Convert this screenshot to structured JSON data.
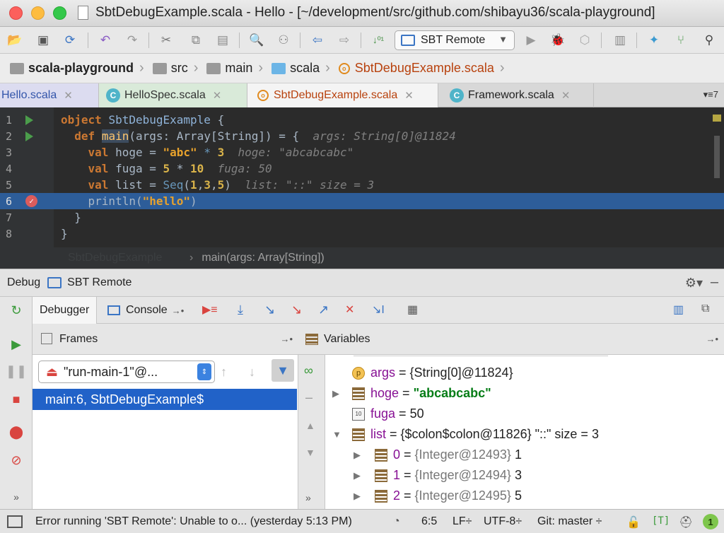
{
  "window": {
    "title": "SbtDebugExample.scala - Hello - [~/development/src/github.com/shibayu36/scala-playground]"
  },
  "toolbar": {
    "run_config_label": "SBT Remote"
  },
  "navbar": {
    "project": "scala-playground",
    "folders": [
      "src",
      "main",
      "scala"
    ],
    "file": "SbtDebugExample.scala"
  },
  "tabs": [
    {
      "label": "Hello.scala"
    },
    {
      "label": "HelloSpec.scala"
    },
    {
      "label": "SbtDebugExample.scala"
    },
    {
      "label": "Framework.scala"
    }
  ],
  "tabs_more": "7",
  "editor": {
    "line_numbers": [
      "1",
      "2",
      "3",
      "4",
      "5",
      "6",
      "7",
      "8"
    ],
    "hints": {
      "line2": "args: String[0]@11824",
      "line3": "hoge: \"abcabcabc\"",
      "line4": "fuga: 50",
      "line5": "list: \"::\" size = 3"
    },
    "breadcrumb_faded": "SbtDebugExample",
    "breadcrumb": "main(args: Array[String])"
  },
  "debug": {
    "label": "Debug",
    "config": "SBT Remote",
    "tab_debugger": "Debugger",
    "tab_console": "Console"
  },
  "frames": {
    "title": "Frames",
    "thread": "\"run-main-1\"@...",
    "selected_frame": "main:6, SbtDebugExample$"
  },
  "variables": {
    "title": "Variables",
    "rows": [
      {
        "name": "args",
        "value": "{String[0]@11824}"
      },
      {
        "name": "hoge",
        "value": "\"abcabcabc\""
      },
      {
        "name": "fuga",
        "value": "50"
      },
      {
        "name": "list",
        "value": "{$colon$colon@11826}",
        "extra": "\"::\" size = 3"
      },
      {
        "name": "0",
        "value": "{Integer@12493}",
        "extra": "1"
      },
      {
        "name": "1",
        "value": "{Integer@12494}",
        "extra": "3"
      },
      {
        "name": "2",
        "value": "{Integer@12495}",
        "extra": "5"
      }
    ]
  },
  "status": {
    "message": "Error running 'SBT Remote': Unable to o... (yesterday 5:13 PM)",
    "position": "6:5",
    "line_sep": "LF÷",
    "encoding": "UTF-8÷",
    "git": "Git: master ÷",
    "t_label": "[T]",
    "notifications": "1"
  }
}
